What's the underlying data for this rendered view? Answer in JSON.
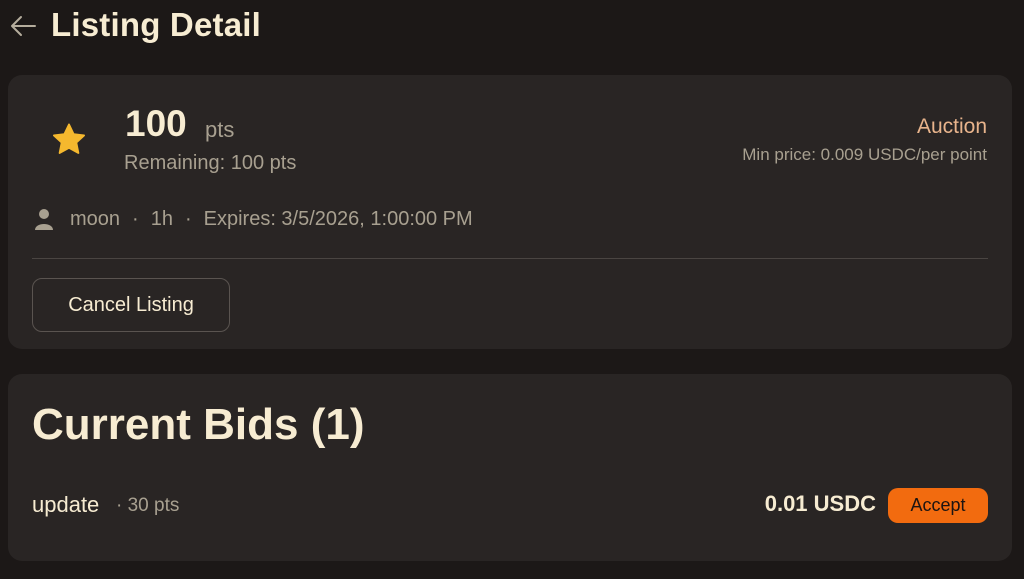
{
  "header": {
    "back_icon": "arrow-left-icon",
    "title": "Listing Detail"
  },
  "listing": {
    "icon": "star-icon",
    "points": "100",
    "points_unit": "pts",
    "remaining": "Remaining: 100 pts",
    "type": "Auction",
    "min_price": "Min price: 0.009 USDC/per point",
    "user_icon": "user-icon",
    "username": "moon",
    "age": "1h",
    "expires": "Expires: 3/5/2026, 1:00:00 PM",
    "separator": "·",
    "cancel_label": "Cancel Listing"
  },
  "bids": {
    "title": "Current Bids (1)",
    "items": [
      {
        "name": "update",
        "meta": "· 30 pts",
        "amount": "0.01 USDC",
        "accept_label": "Accept"
      }
    ]
  },
  "colors": {
    "background": "#1c1817",
    "card": "#292524",
    "accent": "#f26b0f",
    "auction_label": "#e8b48c",
    "star": "#f5b82e"
  }
}
